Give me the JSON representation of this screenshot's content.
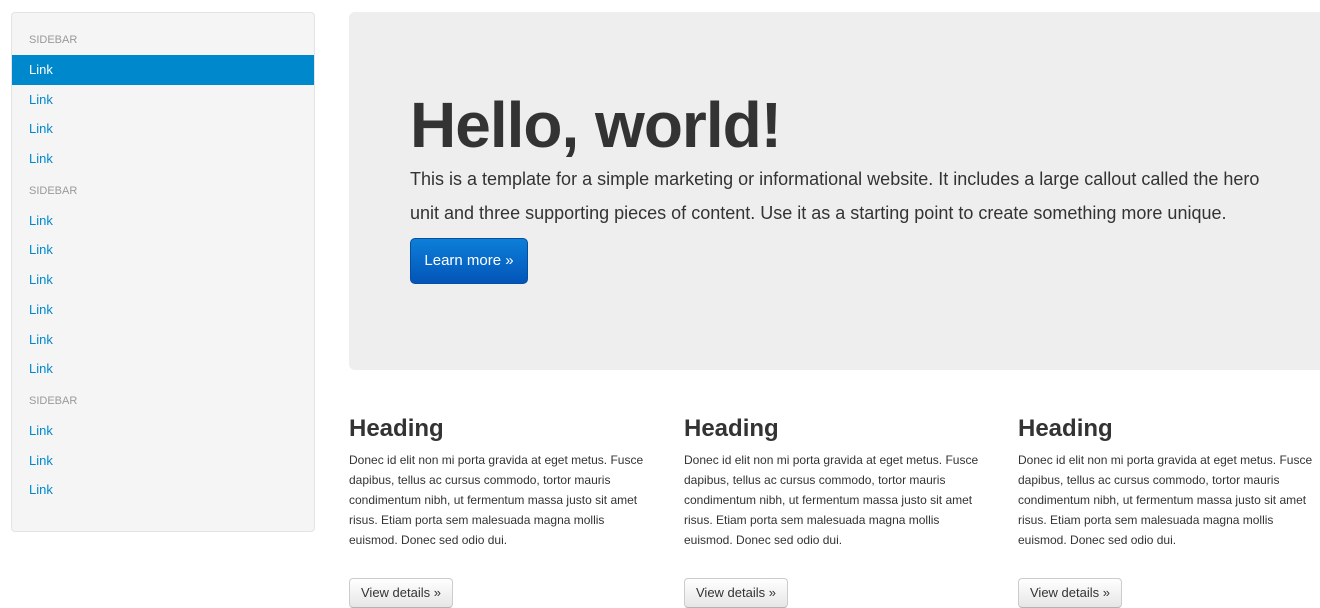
{
  "sidebar": {
    "groups": [
      {
        "header": "SIDEBAR",
        "links": [
          "Link",
          "Link",
          "Link",
          "Link"
        ]
      },
      {
        "header": "SIDEBAR",
        "links": [
          "Link",
          "Link",
          "Link",
          "Link",
          "Link",
          "Link"
        ]
      },
      {
        "header": "SIDEBAR",
        "links": [
          "Link",
          "Link",
          "Link"
        ]
      }
    ],
    "active_link": "group 0, link 0"
  },
  "hero": {
    "title": "Hello, world!",
    "description": "This is a template for a simple marketing or informational website. It includes a large callout called the hero unit and three supporting pieces of content. Use it as a starting point to create something more unique.",
    "button_label": "Learn more »"
  },
  "columns": [
    {
      "heading": "Heading",
      "body": "Donec id elit non mi porta gravida at eget metus. Fusce dapibus, tellus ac cursus commodo, tortor mauris condimentum nibh, ut fermentum massa justo sit amet risus. Etiam porta sem malesuada magna mollis euismod. Donec sed odio dui.",
      "button_label": "View details »"
    },
    {
      "heading": "Heading",
      "body": "Donec id elit non mi porta gravida at eget metus. Fusce dapibus, tellus ac cursus commodo, tortor mauris condimentum nibh, ut fermentum massa justo sit amet risus. Etiam porta sem malesuada magna mollis euismod. Donec sed odio dui.",
      "button_label": "View details »"
    },
    {
      "heading": "Heading",
      "body": "Donec id elit non mi porta gravida at eget metus. Fusce dapibus, tellus ac cursus commodo, tortor mauris condimentum nibh, ut fermentum massa justo sit amet risus. Etiam porta sem malesuada magna mollis euismod. Donec sed odio dui.",
      "button_label": "View details »"
    }
  ],
  "colors": {
    "link": "#0088cc",
    "active_bg": "#0088cc",
    "hero_bg": "#eeeeee",
    "primary_button": "#0355b8"
  }
}
